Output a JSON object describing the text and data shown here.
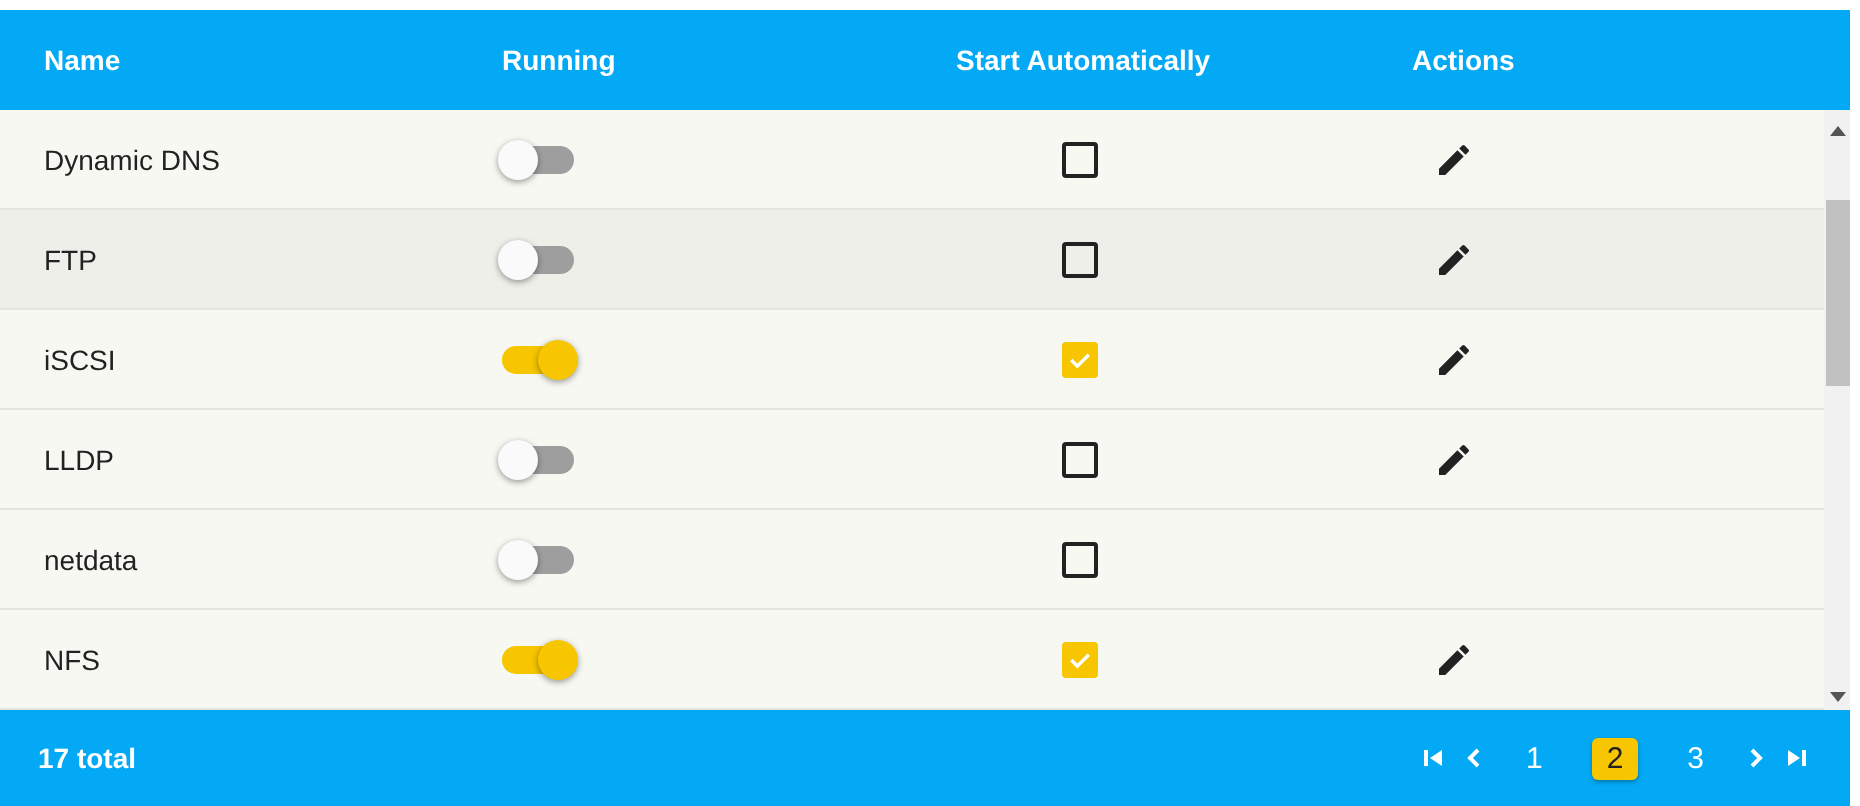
{
  "table": {
    "columns": [
      "Name",
      "Running",
      "Start Automatically",
      "Actions"
    ],
    "rows": [
      {
        "name": "Dynamic DNS",
        "running": false,
        "start_automatically": false,
        "editable": true,
        "highlighted": false
      },
      {
        "name": "FTP",
        "running": false,
        "start_automatically": false,
        "editable": true,
        "highlighted": true
      },
      {
        "name": "iSCSI",
        "running": true,
        "start_automatically": true,
        "editable": true,
        "highlighted": false
      },
      {
        "name": "LLDP",
        "running": false,
        "start_automatically": false,
        "editable": true,
        "highlighted": false
      },
      {
        "name": "netdata",
        "running": false,
        "start_automatically": false,
        "editable": false,
        "highlighted": false
      },
      {
        "name": "NFS",
        "running": true,
        "start_automatically": true,
        "editable": true,
        "highlighted": false
      }
    ]
  },
  "footer": {
    "total": "17 total",
    "pages": [
      {
        "label": "1",
        "selected": false
      },
      {
        "label": "2",
        "selected": true
      },
      {
        "label": "3",
        "selected": false
      }
    ]
  }
}
